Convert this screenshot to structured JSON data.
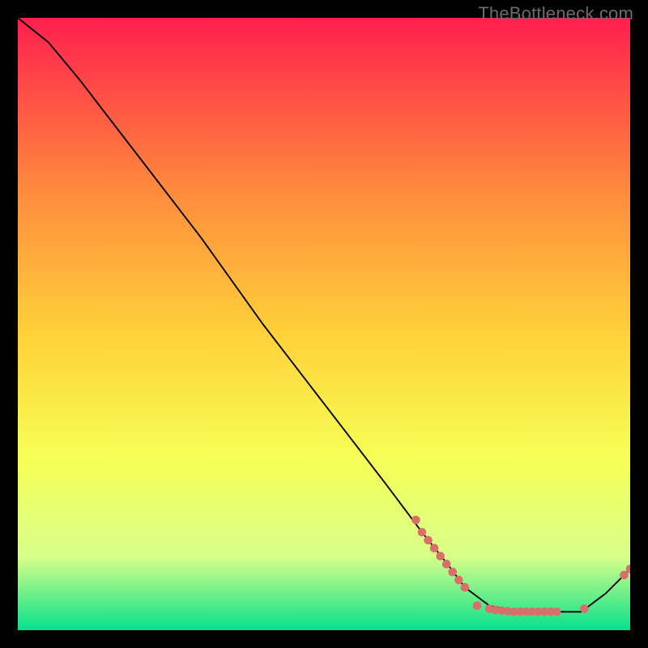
{
  "watermark": "TheBottleneck.com",
  "chart_data": {
    "type": "line",
    "title": "",
    "xlabel": "",
    "ylabel": "",
    "xlim": [
      0,
      100
    ],
    "ylim": [
      0,
      100
    ],
    "grid": false,
    "curve": [
      {
        "x": 0,
        "y": 100
      },
      {
        "x": 5,
        "y": 96
      },
      {
        "x": 10,
        "y": 90
      },
      {
        "x": 20,
        "y": 77
      },
      {
        "x": 30,
        "y": 64
      },
      {
        "x": 40,
        "y": 50
      },
      {
        "x": 50,
        "y": 37
      },
      {
        "x": 60,
        "y": 24
      },
      {
        "x": 66,
        "y": 16
      },
      {
        "x": 70,
        "y": 11
      },
      {
        "x": 73,
        "y": 7
      },
      {
        "x": 77,
        "y": 4
      },
      {
        "x": 82,
        "y": 3
      },
      {
        "x": 87,
        "y": 3
      },
      {
        "x": 92,
        "y": 3
      },
      {
        "x": 96,
        "y": 6
      },
      {
        "x": 100,
        "y": 10
      }
    ],
    "series": [
      {
        "name": "highlighted-points",
        "color": "#d96f6a",
        "values": [
          {
            "x": 65,
            "y": 18
          },
          {
            "x": 66,
            "y": 16
          },
          {
            "x": 67,
            "y": 14.7
          },
          {
            "x": 68,
            "y": 13.4
          },
          {
            "x": 69,
            "y": 12.1
          },
          {
            "x": 70,
            "y": 10.8
          },
          {
            "x": 71,
            "y": 9.5
          },
          {
            "x": 72,
            "y": 8.2
          },
          {
            "x": 73,
            "y": 7
          },
          {
            "x": 75,
            "y": 4
          },
          {
            "x": 77,
            "y": 3.5
          },
          {
            "x": 78,
            "y": 3.3
          },
          {
            "x": 79,
            "y": 3.2
          },
          {
            "x": 80,
            "y": 3.1
          },
          {
            "x": 81,
            "y": 3
          },
          {
            "x": 82,
            "y": 3
          },
          {
            "x": 83,
            "y": 3
          },
          {
            "x": 84,
            "y": 3
          },
          {
            "x": 85,
            "y": 3
          },
          {
            "x": 86,
            "y": 3
          },
          {
            "x": 87,
            "y": 3
          },
          {
            "x": 88,
            "y": 3
          },
          {
            "x": 92.5,
            "y": 3.5
          },
          {
            "x": 99,
            "y": 9
          },
          {
            "x": 100,
            "y": 10
          }
        ]
      }
    ],
    "background_gradient": {
      "top": "#ff1f4e",
      "mid_upper": "#ff8a3d",
      "mid": "#ffd23a",
      "mid_lower": "#f6ff55",
      "low": "#d8ff8a",
      "bottom": "#07e08b"
    }
  }
}
